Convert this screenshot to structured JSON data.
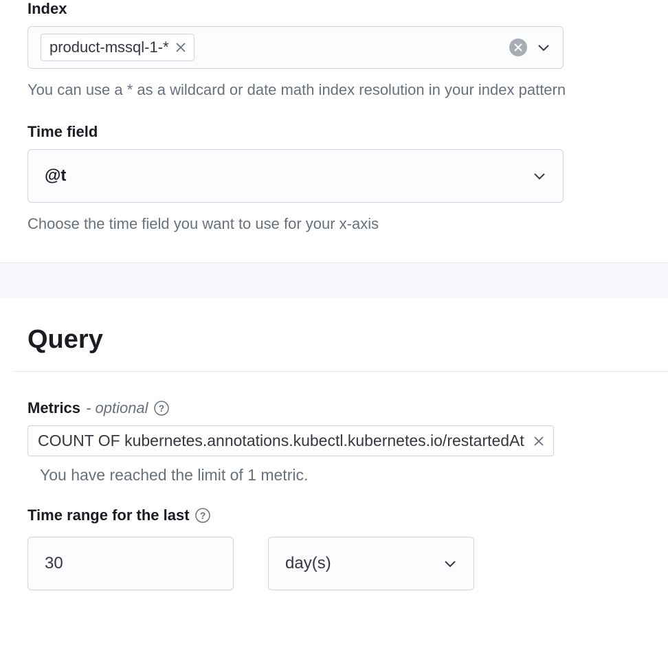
{
  "index": {
    "label": "Index",
    "pill_value": "product-mssql-1-*",
    "help_text": "You can use a * as a wildcard or date math index resolution in your index pattern"
  },
  "time_field": {
    "label": "Time field",
    "value": "@t",
    "help_text": "Choose the time field you want to use for your x-axis"
  },
  "query": {
    "title": "Query",
    "metrics_label": "Metrics",
    "optional_text": " - optional",
    "metric_pill": "COUNT OF kubernetes.annotations.kubectl.kubernetes.io/restartedAt",
    "limit_text": "You have reached the limit of 1 metric.",
    "time_range_label": "Time range for the last",
    "time_range_value": "30",
    "time_range_unit": "day(s)"
  }
}
